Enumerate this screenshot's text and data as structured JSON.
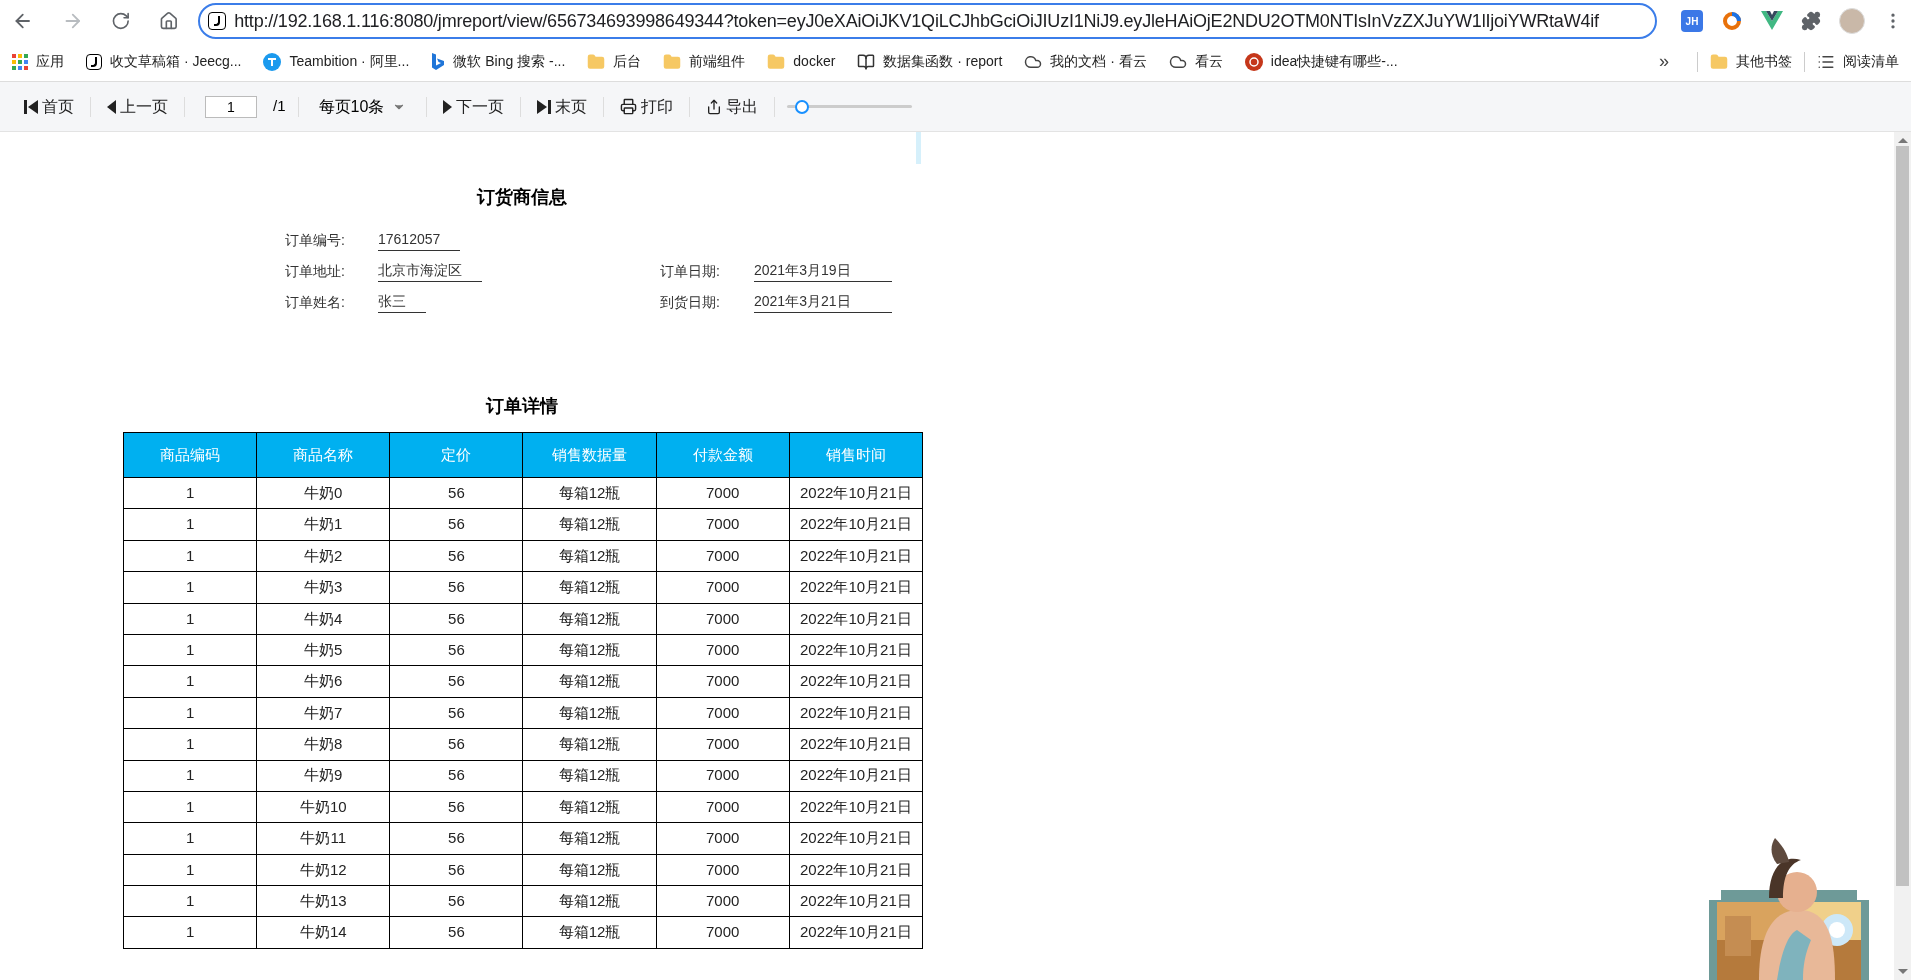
{
  "browser": {
    "address": {
      "url": "http://192.168.1.116:8080/jmreport/view/656734693998649344?token=eyJ0eXAiOiJKV1QiLCJhbGciOiJIUzI1NiJ9.eyJleHAiOjE2NDU2OTM0NTIsInVzZXJuYW1lIjoiYWRtaW4if"
    },
    "extensions": [
      {
        "kind": "badge",
        "label": "JH"
      },
      {
        "kind": "ring"
      },
      {
        "kind": "vue"
      },
      {
        "kind": "puzzle"
      },
      {
        "kind": "avatar"
      }
    ],
    "bookmarks": [
      {
        "kind": "apps",
        "label": "应用"
      },
      {
        "kind": "jeecg",
        "label": "收文草稿箱 · Jeecg..."
      },
      {
        "kind": "teambition",
        "label": "Teambition · 阿里..."
      },
      {
        "kind": "bing",
        "label": "微软 Bing 搜索 -..."
      },
      {
        "kind": "folder",
        "label": "后台"
      },
      {
        "kind": "folder",
        "label": "前端组件"
      },
      {
        "kind": "folder",
        "label": "docker"
      },
      {
        "kind": "book",
        "label": "数据集函数 · report"
      },
      {
        "kind": "cloud",
        "label": "我的文档 · 看云"
      },
      {
        "kind": "cloud",
        "label": "看云"
      },
      {
        "kind": "php",
        "label": "idea快捷键有哪些-..."
      }
    ],
    "overflow": "»",
    "other_bookmarks": [
      {
        "kind": "folder",
        "label": "其他书签"
      },
      {
        "kind": "list",
        "label": "阅读清单"
      }
    ]
  },
  "toolbar": {
    "first": "首页",
    "prev": "上一页",
    "page": "1",
    "page_total": "/1",
    "page_size": "每页10条",
    "next": "下一页",
    "last": "末页",
    "print": "打印",
    "export": "导出",
    "zoom": {
      "level": 0.12
    }
  },
  "report": {
    "supplier": {
      "title": "订货商信息",
      "fields": [
        {
          "label": "订单编号:",
          "value": "17612057"
        },
        {
          "label": "订单地址:",
          "value": "北京市海淀区",
          "side_label": "订单日期:",
          "side_value": "2021年3月19日"
        },
        {
          "label": "订单姓名:",
          "value": "张三",
          "side_label": "到货日期:",
          "side_value": "2021年3月21日"
        }
      ]
    },
    "details": {
      "title": "订单详情",
      "columns": [
        "商品编码",
        "商品名称",
        "定价",
        "销售数据量",
        "付款金额",
        "销售时间"
      ],
      "rows": [
        [
          "1",
          "牛奶0",
          "56",
          "每箱12瓶",
          "7000",
          "2022年10月21日"
        ],
        [
          "1",
          "牛奶1",
          "56",
          "每箱12瓶",
          "7000",
          "2022年10月21日"
        ],
        [
          "1",
          "牛奶2",
          "56",
          "每箱12瓶",
          "7000",
          "2022年10月21日"
        ],
        [
          "1",
          "牛奶3",
          "56",
          "每箱12瓶",
          "7000",
          "2022年10月21日"
        ],
        [
          "1",
          "牛奶4",
          "56",
          "每箱12瓶",
          "7000",
          "2022年10月21日"
        ],
        [
          "1",
          "牛奶5",
          "56",
          "每箱12瓶",
          "7000",
          "2022年10月21日"
        ],
        [
          "1",
          "牛奶6",
          "56",
          "每箱12瓶",
          "7000",
          "2022年10月21日"
        ],
        [
          "1",
          "牛奶7",
          "56",
          "每箱12瓶",
          "7000",
          "2022年10月21日"
        ],
        [
          "1",
          "牛奶8",
          "56",
          "每箱12瓶",
          "7000",
          "2022年10月21日"
        ],
        [
          "1",
          "牛奶9",
          "56",
          "每箱12瓶",
          "7000",
          "2022年10月21日"
        ],
        [
          "1",
          "牛奶10",
          "56",
          "每箱12瓶",
          "7000",
          "2022年10月21日"
        ],
        [
          "1",
          "牛奶11",
          "56",
          "每箱12瓶",
          "7000",
          "2022年10月21日"
        ],
        [
          "1",
          "牛奶12",
          "56",
          "每箱12瓶",
          "7000",
          "2022年10月21日"
        ],
        [
          "1",
          "牛奶13",
          "56",
          "每箱12瓶",
          "7000",
          "2022年10月21日"
        ],
        [
          "1",
          "牛奶14",
          "56",
          "每箱12瓶",
          "7000",
          "2022年10月21日"
        ]
      ]
    }
  }
}
